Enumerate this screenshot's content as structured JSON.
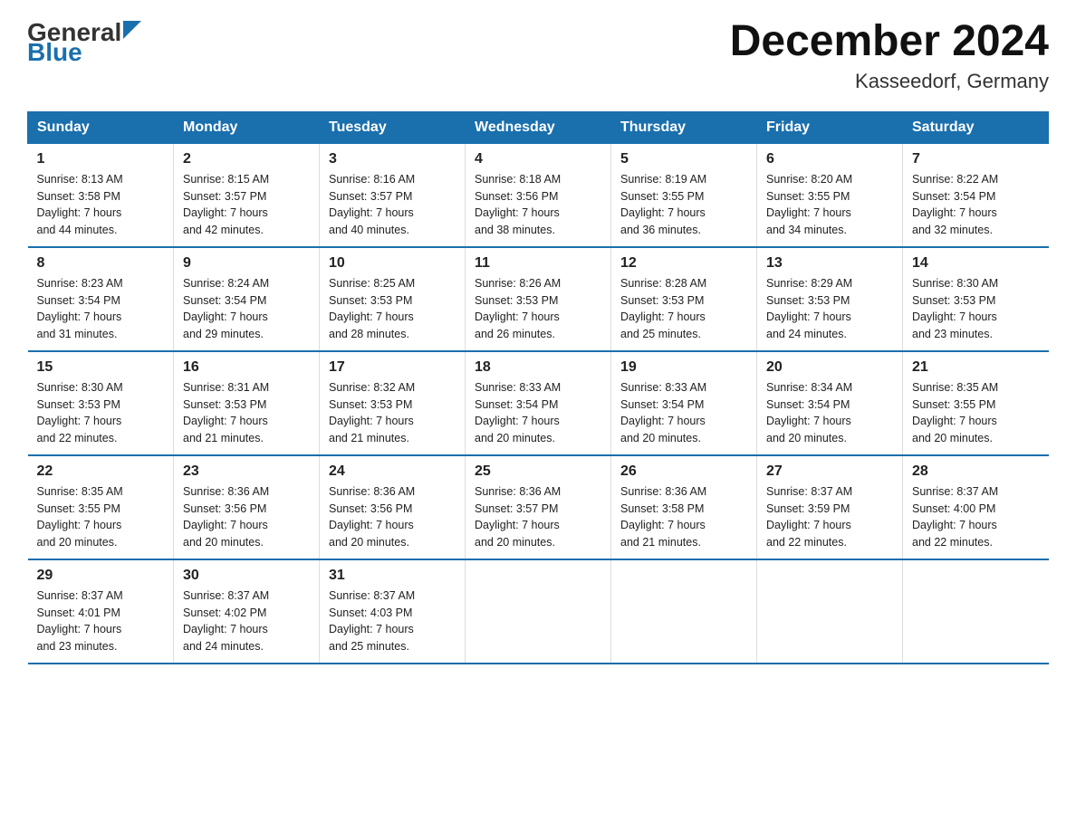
{
  "header": {
    "logo_general": "General",
    "logo_blue": "Blue",
    "title": "December 2024",
    "subtitle": "Kasseedorf, Germany"
  },
  "days_of_week": [
    "Sunday",
    "Monday",
    "Tuesday",
    "Wednesday",
    "Thursday",
    "Friday",
    "Saturday"
  ],
  "weeks": [
    [
      {
        "day": "1",
        "sunrise": "8:13 AM",
        "sunset": "3:58 PM",
        "daylight": "7 hours and 44 minutes."
      },
      {
        "day": "2",
        "sunrise": "8:15 AM",
        "sunset": "3:57 PM",
        "daylight": "7 hours and 42 minutes."
      },
      {
        "day": "3",
        "sunrise": "8:16 AM",
        "sunset": "3:57 PM",
        "daylight": "7 hours and 40 minutes."
      },
      {
        "day": "4",
        "sunrise": "8:18 AM",
        "sunset": "3:56 PM",
        "daylight": "7 hours and 38 minutes."
      },
      {
        "day": "5",
        "sunrise": "8:19 AM",
        "sunset": "3:55 PM",
        "daylight": "7 hours and 36 minutes."
      },
      {
        "day": "6",
        "sunrise": "8:20 AM",
        "sunset": "3:55 PM",
        "daylight": "7 hours and 34 minutes."
      },
      {
        "day": "7",
        "sunrise": "8:22 AM",
        "sunset": "3:54 PM",
        "daylight": "7 hours and 32 minutes."
      }
    ],
    [
      {
        "day": "8",
        "sunrise": "8:23 AM",
        "sunset": "3:54 PM",
        "daylight": "7 hours and 31 minutes."
      },
      {
        "day": "9",
        "sunrise": "8:24 AM",
        "sunset": "3:54 PM",
        "daylight": "7 hours and 29 minutes."
      },
      {
        "day": "10",
        "sunrise": "8:25 AM",
        "sunset": "3:53 PM",
        "daylight": "7 hours and 28 minutes."
      },
      {
        "day": "11",
        "sunrise": "8:26 AM",
        "sunset": "3:53 PM",
        "daylight": "7 hours and 26 minutes."
      },
      {
        "day": "12",
        "sunrise": "8:28 AM",
        "sunset": "3:53 PM",
        "daylight": "7 hours and 25 minutes."
      },
      {
        "day": "13",
        "sunrise": "8:29 AM",
        "sunset": "3:53 PM",
        "daylight": "7 hours and 24 minutes."
      },
      {
        "day": "14",
        "sunrise": "8:30 AM",
        "sunset": "3:53 PM",
        "daylight": "7 hours and 23 minutes."
      }
    ],
    [
      {
        "day": "15",
        "sunrise": "8:30 AM",
        "sunset": "3:53 PM",
        "daylight": "7 hours and 22 minutes."
      },
      {
        "day": "16",
        "sunrise": "8:31 AM",
        "sunset": "3:53 PM",
        "daylight": "7 hours and 21 minutes."
      },
      {
        "day": "17",
        "sunrise": "8:32 AM",
        "sunset": "3:53 PM",
        "daylight": "7 hours and 21 minutes."
      },
      {
        "day": "18",
        "sunrise": "8:33 AM",
        "sunset": "3:54 PM",
        "daylight": "7 hours and 20 minutes."
      },
      {
        "day": "19",
        "sunrise": "8:33 AM",
        "sunset": "3:54 PM",
        "daylight": "7 hours and 20 minutes."
      },
      {
        "day": "20",
        "sunrise": "8:34 AM",
        "sunset": "3:54 PM",
        "daylight": "7 hours and 20 minutes."
      },
      {
        "day": "21",
        "sunrise": "8:35 AM",
        "sunset": "3:55 PM",
        "daylight": "7 hours and 20 minutes."
      }
    ],
    [
      {
        "day": "22",
        "sunrise": "8:35 AM",
        "sunset": "3:55 PM",
        "daylight": "7 hours and 20 minutes."
      },
      {
        "day": "23",
        "sunrise": "8:36 AM",
        "sunset": "3:56 PM",
        "daylight": "7 hours and 20 minutes."
      },
      {
        "day": "24",
        "sunrise": "8:36 AM",
        "sunset": "3:56 PM",
        "daylight": "7 hours and 20 minutes."
      },
      {
        "day": "25",
        "sunrise": "8:36 AM",
        "sunset": "3:57 PM",
        "daylight": "7 hours and 20 minutes."
      },
      {
        "day": "26",
        "sunrise": "8:36 AM",
        "sunset": "3:58 PM",
        "daylight": "7 hours and 21 minutes."
      },
      {
        "day": "27",
        "sunrise": "8:37 AM",
        "sunset": "3:59 PM",
        "daylight": "7 hours and 22 minutes."
      },
      {
        "day": "28",
        "sunrise": "8:37 AM",
        "sunset": "4:00 PM",
        "daylight": "7 hours and 22 minutes."
      }
    ],
    [
      {
        "day": "29",
        "sunrise": "8:37 AM",
        "sunset": "4:01 PM",
        "daylight": "7 hours and 23 minutes."
      },
      {
        "day": "30",
        "sunrise": "8:37 AM",
        "sunset": "4:02 PM",
        "daylight": "7 hours and 24 minutes."
      },
      {
        "day": "31",
        "sunrise": "8:37 AM",
        "sunset": "4:03 PM",
        "daylight": "7 hours and 25 minutes."
      },
      null,
      null,
      null,
      null
    ]
  ],
  "labels": {
    "sunrise": "Sunrise:",
    "sunset": "Sunset:",
    "daylight": "Daylight:"
  }
}
